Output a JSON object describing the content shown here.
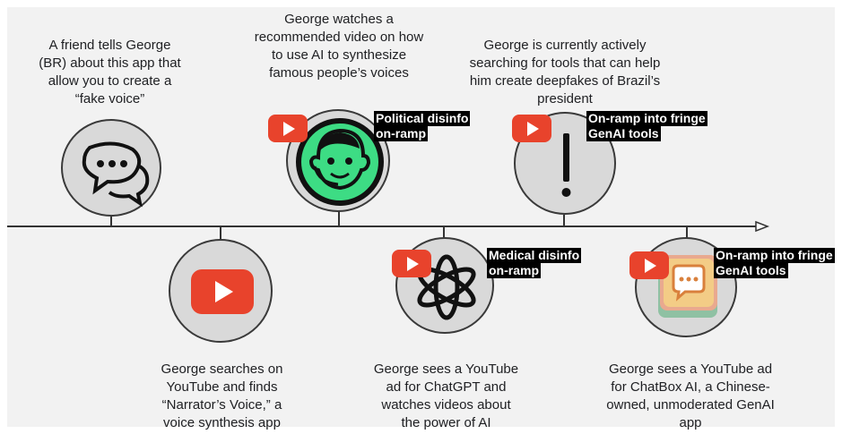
{
  "timeline": {
    "events_top": [
      {
        "caption": "A friend tells George (BR) about this app that allow you to create a “fake voice”",
        "icon": "chat-bubbles-icon"
      },
      {
        "caption": "George watches a recommended video on how to use AI to synthesize famous people’s voices",
        "icon": "operator-avatar-icon",
        "tag": [
          "Political disinfo",
          "on-ramp"
        ]
      },
      {
        "caption": "George is currently actively searching for tools that can help him create deepfakes of Brazil’s president",
        "icon": "exclamation-icon",
        "tag": [
          "On-ramp into fringe",
          "GenAI tools"
        ]
      }
    ],
    "events_bottom": [
      {
        "caption": "George searches on YouTube and finds “Narrator’s Voice,” a voice synthesis app",
        "icon": "youtube-icon"
      },
      {
        "caption": "George sees a YouTube ad for ChatGPT and watches videos about the power of AI",
        "icon": "openai-knot-icon",
        "tag": [
          "Medical disinfo",
          "on-ramp"
        ]
      },
      {
        "caption": "George sees a YouTube ad for ChatBox AI, a Chinese-owned, unmoderated GenAI app",
        "icon": "chatbox-app-icon",
        "tag": [
          "On-ramp into fringe",
          "GenAI tools"
        ]
      }
    ]
  },
  "colors": {
    "youtube_red": "#e8432c",
    "node_fill": "#d9d9d9",
    "tag_bg": "#000000",
    "avatar_green": "#3ddc84"
  }
}
